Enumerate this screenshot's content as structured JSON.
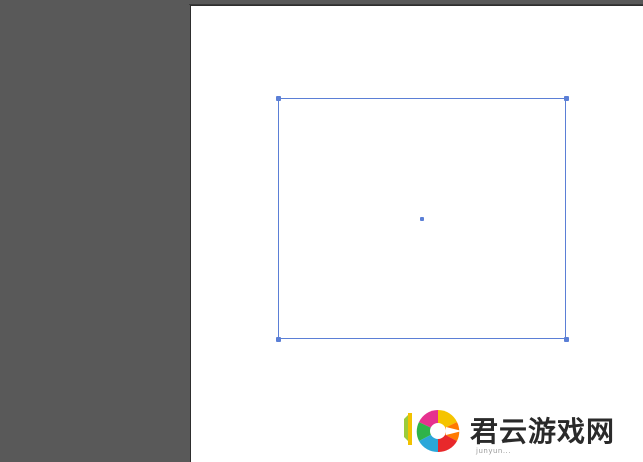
{
  "canvas": {
    "workspace_color": "#595959",
    "artboard_color": "#ffffff",
    "selection_color": "#5b7fd6"
  },
  "watermark": {
    "name": "君云游戏网",
    "url": "junyun..."
  }
}
